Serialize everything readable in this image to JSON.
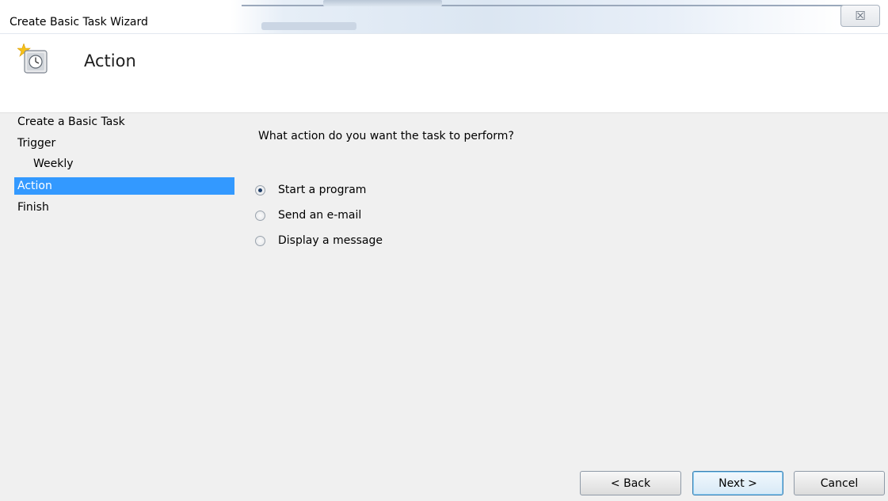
{
  "window": {
    "title": "Create Basic Task Wizard",
    "close_glyph": "☒"
  },
  "header": {
    "title": "Action",
    "icon": "task-scheduler-clock-icon"
  },
  "nav": {
    "items": [
      {
        "label": "Create a Basic Task",
        "selected": false,
        "level": 0
      },
      {
        "label": "Trigger",
        "selected": false,
        "level": 0
      },
      {
        "label": "Weekly",
        "selected": false,
        "level": 1
      },
      {
        "label": "Action",
        "selected": true,
        "level": 0
      },
      {
        "label": "Finish",
        "selected": false,
        "level": 0
      }
    ]
  },
  "main": {
    "question": "What action do you want the task to perform?",
    "options": [
      {
        "label": "Start a program",
        "checked": true
      },
      {
        "label": "Send an e-mail",
        "checked": false
      },
      {
        "label": "Display a message",
        "checked": false
      }
    ]
  },
  "buttons": {
    "back": "< Back",
    "next": "Next >",
    "cancel": "Cancel"
  },
  "colors": {
    "selection": "#3399ff",
    "panel": "#f0f0f0"
  }
}
